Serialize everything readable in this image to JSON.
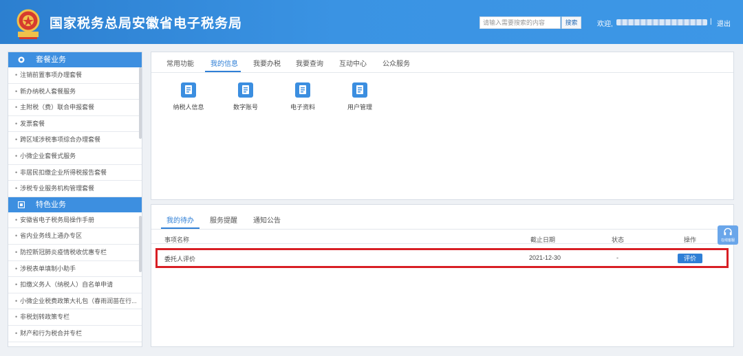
{
  "header": {
    "site_title": "国家税务总局安徽省电子税务局",
    "search_placeholder": "请输入需要搜索的内容",
    "search_button": "搜索",
    "welcome": "欢迎,",
    "separator": "|",
    "logout": "退出"
  },
  "sidebar": {
    "section1_title": "套餐业务",
    "section1_items": [
      "注销前置事项办理套餐",
      "新办纳税人套餐服务",
      "主附税（费）联合申报套餐",
      "发票套餐",
      "跨区域涉税事项综合办理套餐",
      "小微企业套餐式服务",
      "非居民扣缴企业所得税报告套餐",
      "涉税专业服务机构管理套餐"
    ],
    "section2_title": "特色业务",
    "section2_items": [
      "安徽省电子税务局操作手册",
      "省内业务线上通办专区",
      "防控新冠肺炎疫情税收优惠专栏",
      "涉税表单填制小助手",
      "扣缴义务人（纳税人）自名单申请",
      "小微企业税费政策大礼包（春雨润苗在行...",
      "非税划转政策专栏",
      "财产和行为税合并专栏"
    ]
  },
  "top_panel": {
    "tabs": [
      "常用功能",
      "我的信息",
      "我要办税",
      "我要查询",
      "互动中心",
      "公众服务"
    ],
    "active_tab": 1,
    "apps": [
      {
        "label": "纳税人信息",
        "icon": "taxpayer-info-icon"
      },
      {
        "label": "数字账号",
        "icon": "digital-account-icon"
      },
      {
        "label": "电子资料",
        "icon": "electronic-data-icon"
      },
      {
        "label": "用户管理",
        "icon": "user-management-icon"
      }
    ]
  },
  "bottom_panel": {
    "tabs": [
      "我的待办",
      "服务提醒",
      "通知公告"
    ],
    "active_tab": 0,
    "columns": [
      "事项名称",
      "截止日期",
      "状态",
      "操作"
    ],
    "rows": [
      {
        "name": "委托人评价",
        "deadline": "2021-12-30",
        "status": "-",
        "action": "评价"
      }
    ]
  },
  "float_service": {
    "label": "在线客服"
  },
  "colors": {
    "header_blue": "#3a93e3",
    "sidebar_header_blue": "#3d8fe0",
    "accent_blue": "#2f7fd6",
    "highlight_red": "#d81e24"
  }
}
